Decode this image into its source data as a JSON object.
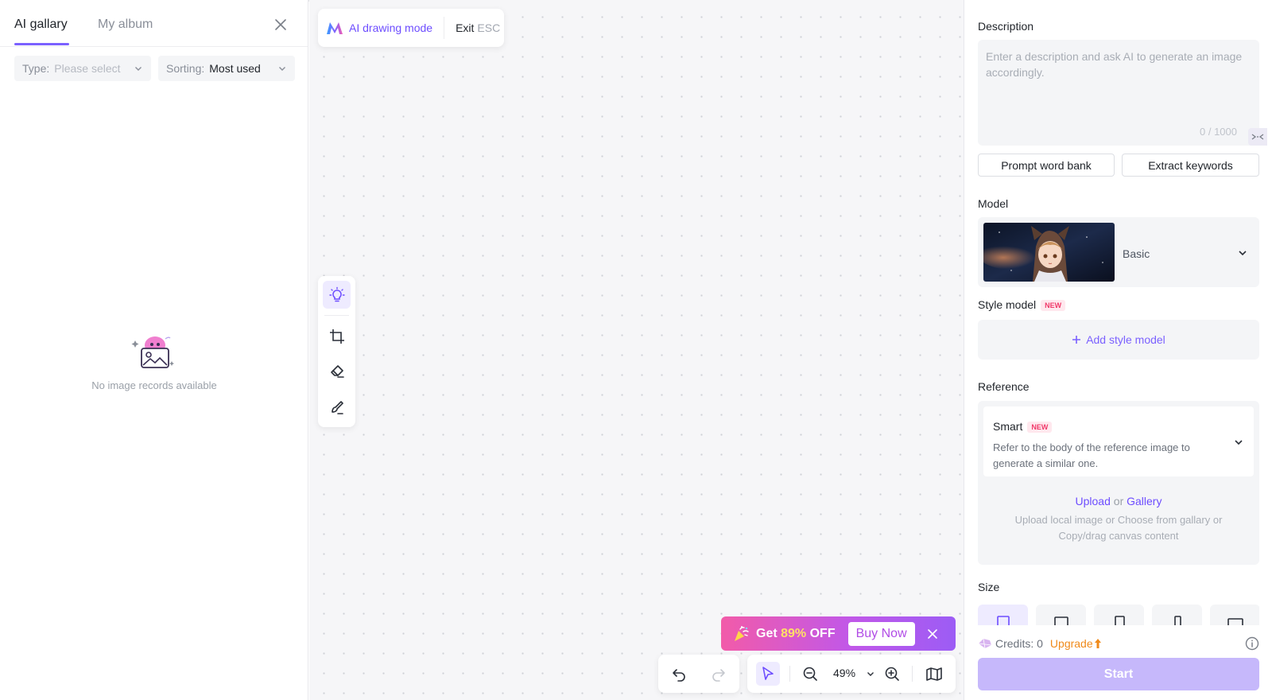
{
  "left_panel": {
    "tabs": [
      {
        "label": "AI gallary",
        "active": true
      },
      {
        "label": "My album",
        "active": false
      }
    ],
    "filters": {
      "type_label": "Type:",
      "type_placeholder": "Please select",
      "sorting_label": "Sorting:",
      "sorting_value": "Most used"
    },
    "empty_text": "No image records available"
  },
  "canvas": {
    "mode_label": "AI drawing mode",
    "exit_label": "Exit",
    "exit_shortcut": "ESC",
    "tools": [
      "lightbulb-icon",
      "crop-icon",
      "eraser-icon",
      "brush-icon"
    ],
    "zoom": "49%"
  },
  "promo": {
    "prefix": "Get ",
    "percent": "89%",
    "suffix": " OFF",
    "buy_label": "Buy Now"
  },
  "right_panel": {
    "description": {
      "title": "Description",
      "placeholder": "Enter a description and ask AI to generate an image accordingly.",
      "count": "0 / 1000"
    },
    "prompt_bank_label": "Prompt word bank",
    "extract_keywords_label": "Extract keywords",
    "model": {
      "title": "Model",
      "name": "Basic"
    },
    "style_model": {
      "title": "Style model",
      "badge": "NEW",
      "add_label": "Add style model"
    },
    "reference": {
      "title": "Reference",
      "mode": "Smart",
      "badge": "NEW",
      "desc": "Refer to the body of the reference image to generate a similar one.",
      "upload_label": "Upload",
      "or_label": "or",
      "gallery_label": "Gallery",
      "hint": "Upload local image or Choose from gallary or Copy/drag canvas content"
    },
    "size": {
      "title": "Size"
    },
    "credits_label": "Credits: 0",
    "upgrade_label": "Upgrade",
    "start_label": "Start"
  },
  "colors": {
    "accent": "#7b61ff",
    "upgrade": "#f08a1a",
    "start_disabled": "#c6b8fb"
  }
}
